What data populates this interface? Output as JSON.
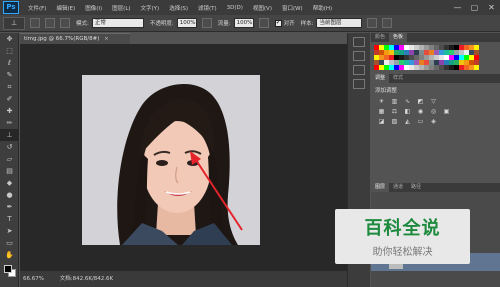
{
  "menubar": {
    "logo": "Ps",
    "items": [
      "文件(F)",
      "编辑(E)",
      "图像(I)",
      "图层(L)",
      "文字(Y)",
      "选择(S)",
      "滤镜(T)",
      "3D(D)",
      "视图(V)",
      "窗口(W)",
      "帮助(H)"
    ],
    "window_controls": [
      "—",
      "▢",
      "✕"
    ]
  },
  "options": {
    "mode_label": "模式:",
    "mode_value": "正常",
    "opacity_label": "不透明度:",
    "opacity_value": "100%",
    "flow_label": "流量:",
    "flow_value": "100%",
    "aligned_label": "对齐",
    "sample_label": "样本:",
    "sample_value": "当前图层"
  },
  "document": {
    "tab_title": "timg.jpg @ 66.7%(RGB/8#)",
    "close": "×"
  },
  "status": {
    "zoom": "66.67%",
    "doc_info": "文档:842.6K/842.6K"
  },
  "panels": {
    "color_tabs": [
      "颜色",
      "色板"
    ],
    "adjust_tabs": [
      "调整",
      "样式"
    ],
    "adjust_title": "添加调整",
    "layer_tabs": [
      "图层",
      "通道",
      "路径"
    ],
    "swatch_colors": [
      "#ff0000",
      "#ffff00",
      "#00ff00",
      "#00ffff",
      "#0000ff",
      "#ff00ff",
      "#ffffff",
      "#e6e6e6",
      "#cccccc",
      "#b3b3b3",
      "#999999",
      "#808080",
      "#666666",
      "#4d4d4d",
      "#333333",
      "#1a1a1a",
      "#000000",
      "#ed1c24",
      "#f26522",
      "#f7941d",
      "#fff200"
    ]
  },
  "watermark": {
    "main": "百科全说",
    "sub": "助你轻松解决"
  }
}
